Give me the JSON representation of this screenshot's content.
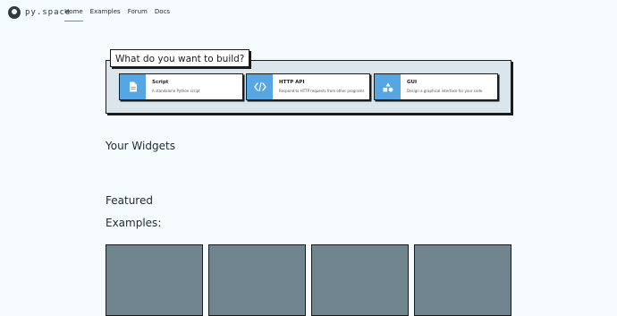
{
  "header": {
    "logo_text": "py.space",
    "nav": [
      {
        "label": "Home",
        "active": true
      },
      {
        "label": "Examples",
        "active": false
      },
      {
        "label": "Forum",
        "active": false
      },
      {
        "label": "Docs",
        "active": false
      }
    ]
  },
  "build": {
    "title": "What do you want to build?",
    "cards": [
      {
        "title": "Script",
        "description": "A standalone Python script",
        "icon": "document-icon"
      },
      {
        "title": "HTTP API",
        "description": "Respond to HTTP requests from other programs",
        "icon": "code-icon"
      },
      {
        "title": "GUI",
        "description": "Design a graphical interface for your code",
        "icon": "shapes-icon"
      }
    ]
  },
  "widgets": {
    "heading": "Your Widgets"
  },
  "featured": {
    "heading_line1": "Featured",
    "heading_line2": "Examples:",
    "tile_count": 4
  },
  "colors": {
    "page_background": "#f6fbfe",
    "accent": "#46a3a1",
    "card_icon_bg": "#56a6e4",
    "panel_bg": "#dbe6ec",
    "tile_bg": "#708590"
  }
}
